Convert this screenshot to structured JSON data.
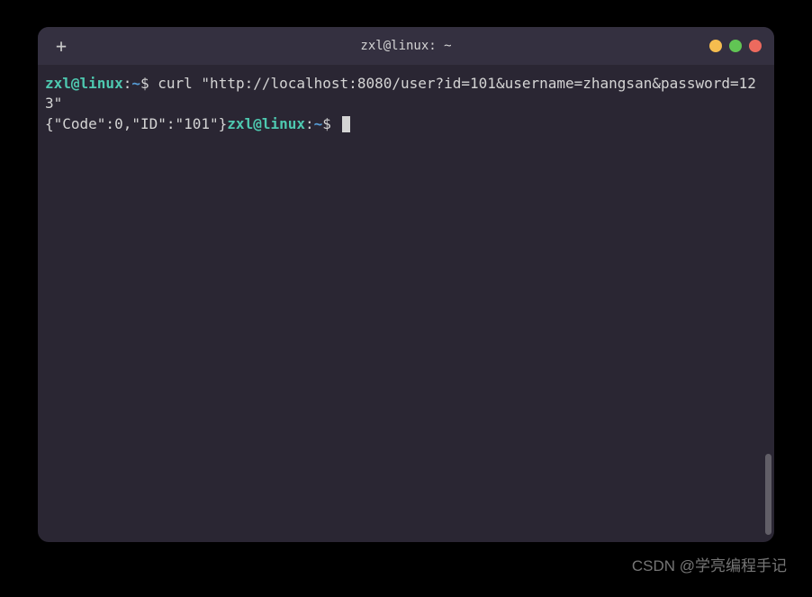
{
  "titlebar": {
    "title": "zxl@linux: ~",
    "new_tab_label": "+"
  },
  "prompt1": {
    "user_host": "zxl@linux",
    "separator": ":",
    "path": "~",
    "dollar": "$",
    "command": " curl \"http://localhost:8080/user?id=101&username=zhangsan&password=123\""
  },
  "output1": "{\"Code\":0,\"ID\":\"101\"}",
  "prompt2": {
    "user_host": "zxl@linux",
    "separator": ":",
    "path": "~",
    "dollar": "$"
  },
  "watermark": "CSDN @学亮编程手记"
}
